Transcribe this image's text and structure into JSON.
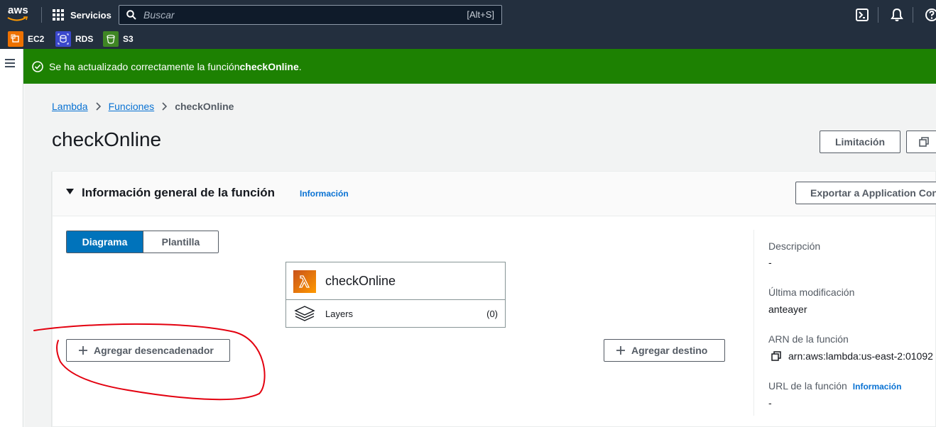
{
  "topnav": {
    "logo_text": "aws",
    "services_label": "Servicios",
    "search_placeholder": "Buscar",
    "search_shortcut": "[Alt+S]"
  },
  "favorites": [
    {
      "label": "EC2",
      "color": "#ed7100",
      "icon": "ec2-icon"
    },
    {
      "label": "RDS",
      "color": "#3b48cc",
      "icon": "rds-icon"
    },
    {
      "label": "S3",
      "color": "#3f8624",
      "icon": "s3-icon"
    }
  ],
  "flash": {
    "message_prefix": "Se ha actualizado correctamente la función ",
    "function_name": "checkOnline",
    "message_suffix": ".",
    "color": "#1d8102"
  },
  "breadcrumb": {
    "items": [
      "Lambda",
      "Funciones"
    ],
    "current": "checkOnline"
  },
  "page": {
    "title": "checkOnline",
    "throttle_button": "Limitación"
  },
  "overview": {
    "title": "Información general de la función",
    "info_link": "Información",
    "export_button": "Exportar a Application Con",
    "tabs": [
      "Diagrama",
      "Plantilla"
    ],
    "function_card": {
      "name": "checkOnline",
      "layers_label": "Layers",
      "layers_count": "(0)"
    },
    "add_trigger": "Agregar desencadenador",
    "add_destination": "Agregar destino"
  },
  "details": {
    "description_label": "Descripción",
    "description_value": "-",
    "modified_label": "Última modificación",
    "modified_value": "anteayer",
    "arn_label": "ARN de la función",
    "arn_value": "arn:aws:lambda:us-east-2:01092",
    "url_label": "URL de la función",
    "url_info": "Información",
    "url_value": "-"
  },
  "annotation": {
    "color": "#e3000f",
    "shape": "hand-drawn-circle"
  }
}
